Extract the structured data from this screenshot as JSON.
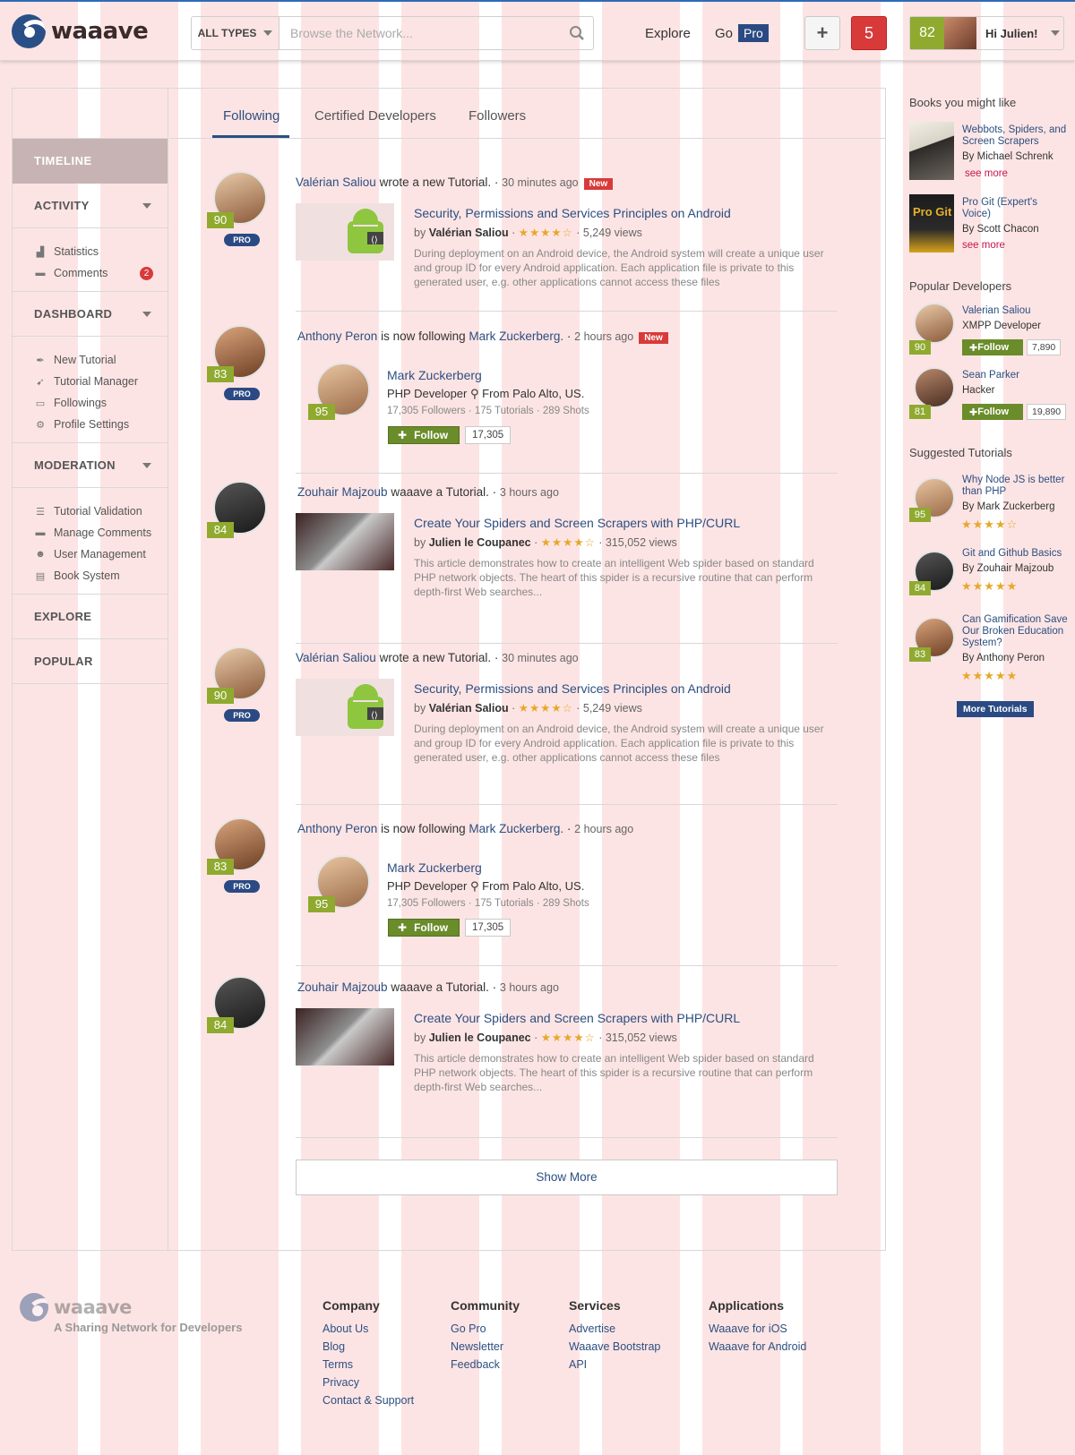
{
  "brand": {
    "name": "waaave",
    "tagline": "A Sharing Network for Developers"
  },
  "header": {
    "type_filter": "ALL TYPES",
    "search_placeholder": "Browse the Network...",
    "explore": "Explore",
    "go": "Go",
    "pro": "Pro",
    "add": "+",
    "notifications": "5",
    "user_score": "82",
    "greeting": "Hi Julien!"
  },
  "sidebar": {
    "timeline": "TIMELINE",
    "activity": {
      "title": "ACTIVITY",
      "items": [
        {
          "label": "Statistics",
          "icon": "chart-icon"
        },
        {
          "label": "Comments",
          "icon": "comment-icon",
          "badge": "2"
        }
      ]
    },
    "dashboard": {
      "title": "DASHBOARD",
      "items": [
        {
          "label": "New Tutorial",
          "icon": "feather-icon"
        },
        {
          "label": "Tutorial Manager",
          "icon": "rocket-icon"
        },
        {
          "label": "Followings",
          "icon": "followings-icon"
        },
        {
          "label": "Profile Settings",
          "icon": "gear-icon"
        }
      ]
    },
    "moderation": {
      "title": "MODERATION",
      "items": [
        {
          "label": "Tutorial Validation",
          "icon": "list-plus-icon"
        },
        {
          "label": "Manage Comments",
          "icon": "comment-icon"
        },
        {
          "label": "User Management",
          "icon": "users-icon"
        },
        {
          "label": "Book System",
          "icon": "book-icon"
        }
      ]
    },
    "explore": "EXPLORE",
    "popular": "POPULAR"
  },
  "tabs": [
    "Following",
    "Certified Developers",
    "Followers"
  ],
  "feed": [
    {
      "type": "tutorial",
      "user": "Valérian Saliou",
      "action": "wrote a new Tutorial.",
      "time": "30 minutes ago",
      "new": "New",
      "score": "90",
      "pro": "PRO",
      "title": "Security, Permissions and Services Principles on Android",
      "author": "Valérian Saliou",
      "stars": "★★★★☆",
      "views": "5,249 views",
      "desc": "During deployment on an Android device, the Android system will create a unique user and group ID for every Android application. Each application file is private to this generated user, e.g. other applications cannot access these files"
    },
    {
      "type": "follow",
      "user": "Anthony Peron",
      "action": "is now following",
      "target": "Mark Zuckerberg.",
      "time": "2 hours ago",
      "new": "New",
      "score": "83",
      "pro": "PRO",
      "card": {
        "name": "Mark Zuckerberg",
        "role": "PHP Developer",
        "location": "From Palo Alto, US.",
        "followers": "17,305 Followers",
        "tutorials": "175 Tutorials",
        "shots": "289 Shots",
        "score": "95",
        "follow": "Follow",
        "count": "17,305"
      }
    },
    {
      "type": "tutorial",
      "user": "Zouhair Majzoub",
      "action": "waaave a Tutorial.",
      "time": "3 hours ago",
      "score": "84",
      "title": "Create Your Spiders and Screen Scrapers with PHP/CURL",
      "author": "Julien le Coupanec",
      "stars": "★★★★☆",
      "views": "315,052 views",
      "desc": "This article demonstrates how to create an intelligent Web spider based on standard PHP network objects. The heart of this spider is a recursive routine that can perform depth-first Web searches..."
    },
    {
      "type": "tutorial",
      "user": "Valérian Saliou",
      "action": "wrote a new Tutorial.",
      "time": "30 minutes ago",
      "score": "90",
      "pro": "PRO",
      "title": "Security, Permissions and Services Principles on Android",
      "author": "Valérian Saliou",
      "stars": "★★★★☆",
      "views": "5,249 views",
      "desc": "During deployment on an Android device, the Android system will create a unique user and group ID for every Android application. Each application file is private to this generated user, e.g. other applications cannot access these files"
    },
    {
      "type": "follow",
      "user": "Anthony Peron",
      "action": "is now following",
      "target": "Mark Zuckerberg.",
      "time": "2 hours ago",
      "score": "83",
      "pro": "PRO",
      "card": {
        "name": "Mark Zuckerberg",
        "role": "PHP Developer",
        "location": "From Palo Alto, US.",
        "followers": "17,305 Followers",
        "tutorials": "175 Tutorials",
        "shots": "289 Shots",
        "score": "95",
        "follow": "Follow",
        "count": "17,305"
      }
    },
    {
      "type": "tutorial",
      "user": "Zouhair Majzoub",
      "action": "waaave a Tutorial.",
      "time": "3 hours ago",
      "score": "84",
      "title": "Create Your Spiders and Screen Scrapers with PHP/CURL",
      "author": "Julien le Coupanec",
      "stars": "★★★★☆",
      "views": "315,052 views",
      "desc": "This article demonstrates how to create an intelligent Web spider based on standard PHP network objects. The heart of this spider is a recursive routine that can perform depth-first Web searches..."
    }
  ],
  "show_more": "Show More",
  "right": {
    "books_title": "Books you might like",
    "books": [
      {
        "title": "Webbots, Spiders, and Screen Scrapers",
        "by": "By Michael Schrenk",
        "more": "see more"
      },
      {
        "title": "Pro Git (Expert's Voice)",
        "by": "By Scott Chacon",
        "more": "see more",
        "cover_text": "Pro Git"
      }
    ],
    "devs_title": "Popular Developers",
    "devs": [
      {
        "name": "Valerian Saliou",
        "role": "XMPP Developer",
        "score": "90",
        "follow": "Follow",
        "count": "7,890"
      },
      {
        "name": "Sean Parker",
        "role": "Hacker",
        "score": "81",
        "follow": "Follow",
        "count": "19,890"
      }
    ],
    "tuts_title": "Suggested Tutorials",
    "tuts": [
      {
        "title": "Why Node JS is better than PHP",
        "by": "By Mark Zuckerberg",
        "score": "95",
        "stars": "★★★★☆"
      },
      {
        "title": "Git and Github Basics",
        "by": "By Zouhair Majzoub",
        "score": "84",
        "stars": "★★★★★"
      },
      {
        "title": "Can Gamification Save Our Broken Education System?",
        "by": "By Anthony Peron",
        "score": "83",
        "stars": "★★★★★"
      }
    ],
    "more_tutorials": "More Tutorials"
  },
  "footer": {
    "columns": [
      {
        "title": "Company",
        "links": [
          "About Us",
          "Blog",
          "Terms",
          "Privacy",
          "Contact & Support"
        ]
      },
      {
        "title": "Community",
        "links": [
          "Go Pro",
          "Newsletter",
          "Feedback"
        ]
      },
      {
        "title": "Services",
        "links": [
          "Advertise",
          "Waaave Bootstrap",
          "API"
        ]
      },
      {
        "title": "Applications",
        "links": [
          "Waaave for iOS",
          "Waaave for Android"
        ]
      }
    ]
  },
  "colors": {
    "brand_blue": "#2b4a83",
    "link": "#2c4f80",
    "score_green": "#8faa2f",
    "alert_red": "#d83a3a",
    "follow_green": "#6a8c2a"
  }
}
